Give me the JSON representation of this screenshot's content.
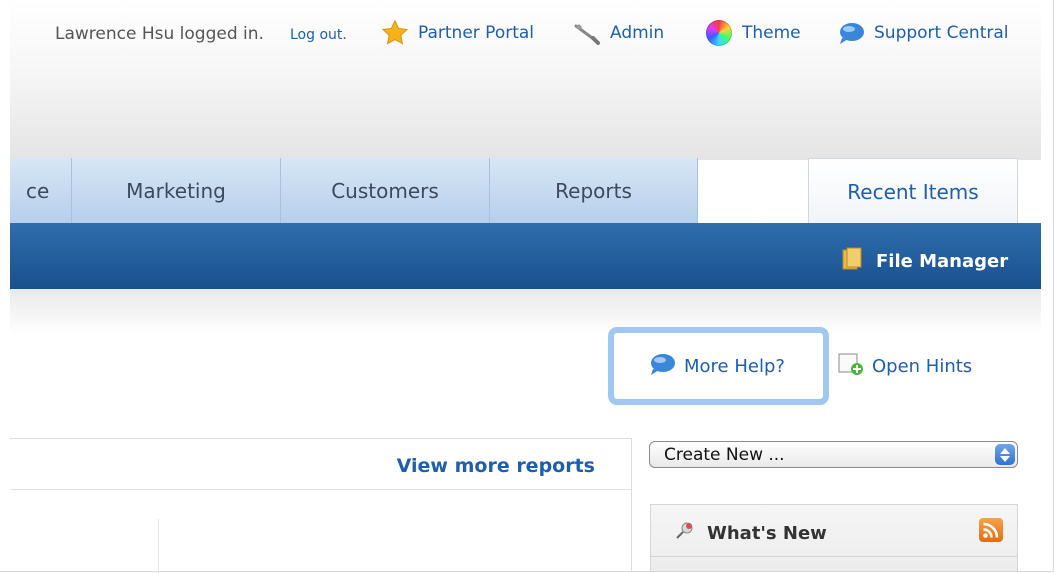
{
  "topbar": {
    "user_text": "Lawrence Hsu logged in.",
    "logout": "Log out.",
    "partner_portal": "Partner Portal",
    "admin": "Admin",
    "theme": "Theme",
    "support_central": "Support Central"
  },
  "tabs": {
    "partial": "ce",
    "marketing": "Marketing",
    "customers": "Customers",
    "reports": "Reports",
    "recent_items": "Recent Items"
  },
  "navbar": {
    "file_manager": "File Manager"
  },
  "help": {
    "more_help": "More Help?",
    "open_hints": "Open Hints"
  },
  "reports_panel": {
    "view_more": "View more reports"
  },
  "create_select": {
    "value": "Create New ..."
  },
  "whats_new": {
    "title": "What's New"
  },
  "colors": {
    "link": "#1d5fae",
    "navbar": "#1f5a9a",
    "tab": "#c6daf0",
    "highlight": "#9fc7f2"
  }
}
